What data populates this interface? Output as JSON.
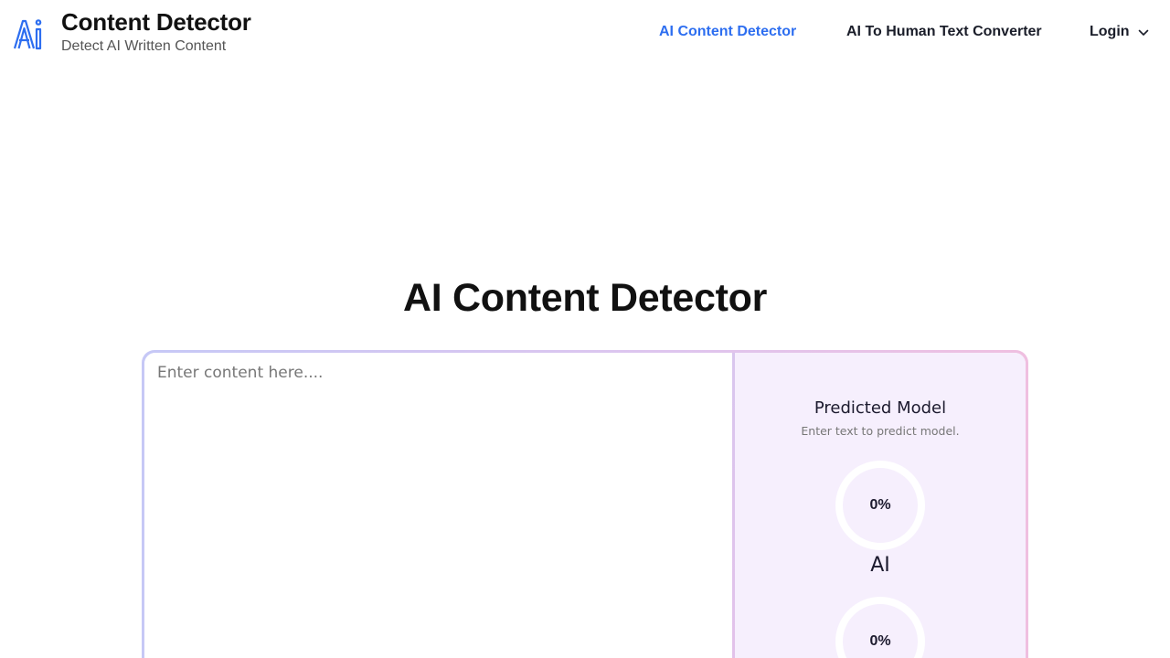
{
  "brand": {
    "title": "Content Detector",
    "tagline": "Detect AI Written Content",
    "logo_icon": "ai-logo-icon",
    "accent_color": "#2d6ef0"
  },
  "nav": {
    "items": [
      {
        "label": "AI Content Detector",
        "active": true
      },
      {
        "label": "AI To Human Text Converter",
        "active": false
      },
      {
        "label": "Login",
        "active": false,
        "icon": "chevron-down-icon"
      }
    ]
  },
  "main": {
    "title": "AI Content Detector",
    "editor": {
      "placeholder": "Enter content here....",
      "value": ""
    },
    "result": {
      "title": "Predicted Model",
      "hint": "Enter text to predict model.",
      "scores": [
        {
          "value": "0%",
          "label": "AI",
          "percent": 0
        },
        {
          "value": "0%",
          "percent": 0
        }
      ]
    }
  }
}
